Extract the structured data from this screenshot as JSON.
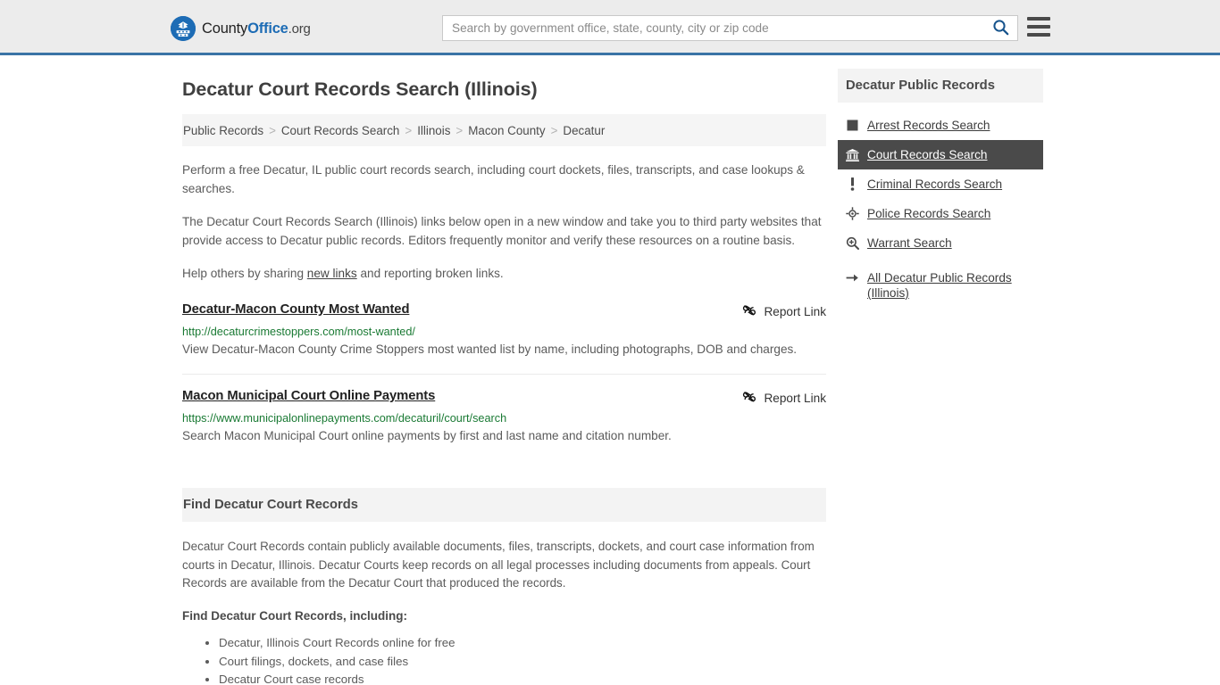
{
  "header": {
    "brand": {
      "part1": "County",
      "part2": "Office",
      "part3": ".org",
      "logo_icon": "eagle-seal-icon"
    },
    "search": {
      "placeholder": "Search by government office, state, county, city or zip code",
      "value": "",
      "search_icon": "search-icon"
    },
    "menu_icon": "hamburger-menu-icon"
  },
  "page": {
    "title": "Decatur Court Records Search (Illinois)"
  },
  "breadcrumb": {
    "separator": ">",
    "items": [
      {
        "label": "Public Records"
      },
      {
        "label": "Court Records Search"
      },
      {
        "label": "Illinois"
      },
      {
        "label": "Macon County"
      },
      {
        "label": "Decatur"
      }
    ]
  },
  "intro": {
    "p1": "Perform a free Decatur, IL public court records search, including court dockets, files, transcripts, and case lookups & searches.",
    "p2": "The Decatur Court Records Search (Illinois) links below open in a new window and take you to third party websites that provide access to Decatur public records. Editors frequently monitor and verify these resources on a routine basis.",
    "p3_before": "Help others by sharing ",
    "p3_link": "new links",
    "p3_after": " and reporting broken links."
  },
  "results": {
    "report_label": "Report Link",
    "report_icon": "broken-link-icon",
    "items": [
      {
        "title": "Decatur-Macon County Most Wanted",
        "url": "http://decaturcrimestoppers.com/most-wanted/",
        "description": "View Decatur-Macon County Crime Stoppers most wanted list by name, including photographs, DOB and charges."
      },
      {
        "title": "Macon Municipal Court Online Payments",
        "url": "https://www.municipalonlinepayments.com/decaturil/court/search",
        "description": "Search Macon Municipal Court online payments by first and last name and citation number."
      }
    ]
  },
  "find_section": {
    "heading": "Find Decatur Court Records",
    "body": "Decatur Court Records contain publicly available documents, files, transcripts, dockets, and court case information from courts in Decatur, Illinois. Decatur Courts keep records on all legal processes including documents from appeals. Court Records are available from the Decatur Court that produced the records.",
    "subheading": "Find Decatur Court Records, including:",
    "list": [
      "Decatur, Illinois Court Records online for free",
      "Court filings, dockets, and case files",
      "Decatur Court case records"
    ]
  },
  "sidebar": {
    "heading": "Decatur Public Records",
    "items": [
      {
        "label": "Arrest Records Search",
        "icon": "filled-square-icon",
        "active": false
      },
      {
        "label": "Court Records Search",
        "icon": "courthouse-icon",
        "active": true
      },
      {
        "label": "Criminal Records Search",
        "icon": "exclamation-icon",
        "active": false
      },
      {
        "label": "Police Records Search",
        "icon": "crosshair-target-icon",
        "active": false
      },
      {
        "label": "Warrant Search",
        "icon": "magnifier-plus-icon",
        "active": false
      },
      {
        "label": "All Decatur Public Records (Illinois)",
        "icon": "arrow-right-icon",
        "active": false
      }
    ]
  },
  "colors": {
    "header_bg": "#ececec",
    "header_border": "#3a74a6",
    "brand_blue": "#1d6cb5",
    "accent_dark": "#4a4a4a",
    "url_green": "#1a7a34",
    "panel_gray": "#f3f3f3",
    "text_gray": "#5b5b5b"
  }
}
